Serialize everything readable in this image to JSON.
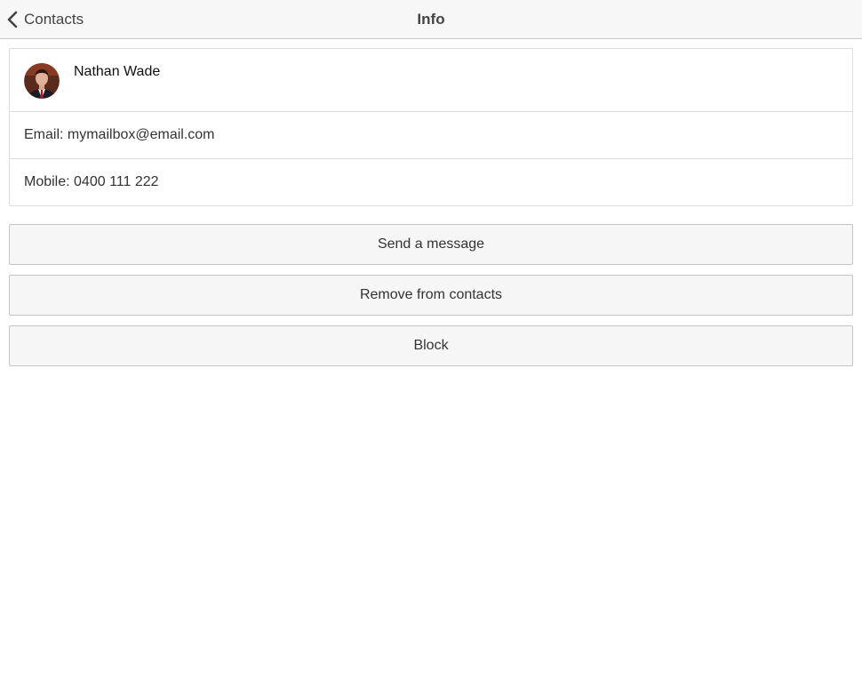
{
  "navbar": {
    "back_label": "Contacts",
    "title": "Info",
    "back_icon": "chevron-left-icon"
  },
  "contact": {
    "name": "Nathan Wade",
    "email_line": "Email: mymailbox@email.com",
    "mobile_line": "Mobile: 0400 111 222",
    "avatar_icon": "avatar-photo"
  },
  "actions": [
    {
      "label": "Send a message"
    },
    {
      "label": "Remove from contacts"
    },
    {
      "label": "Block"
    }
  ],
  "colors": {
    "navbar_bg": "#f7f7f7",
    "button_bg": "#f6f6f6",
    "border": "#dddddd"
  }
}
